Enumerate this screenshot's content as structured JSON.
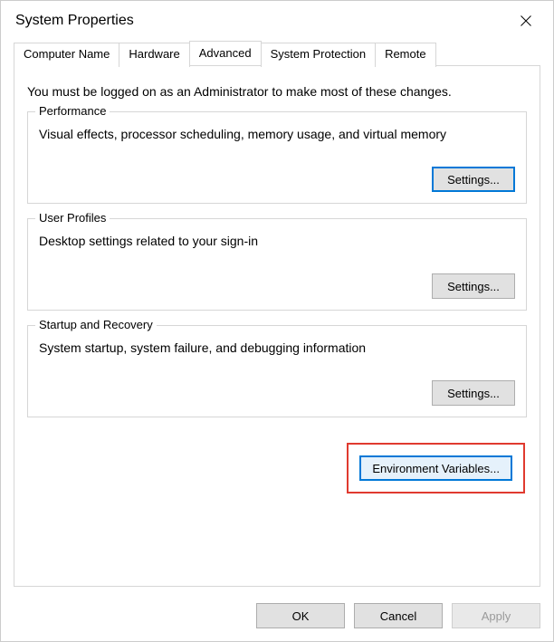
{
  "window": {
    "title": "System Properties"
  },
  "tabs": {
    "items": [
      {
        "label": "Computer Name"
      },
      {
        "label": "Hardware"
      },
      {
        "label": "Advanced"
      },
      {
        "label": "System Protection"
      },
      {
        "label": "Remote"
      }
    ],
    "active_index": 2
  },
  "admin_note": "You must be logged on as an Administrator to make most of these changes.",
  "groups": {
    "performance": {
      "title": "Performance",
      "desc": "Visual effects, processor scheduling, memory usage, and virtual memory",
      "button": "Settings..."
    },
    "user_profiles": {
      "title": "User Profiles",
      "desc": "Desktop settings related to your sign-in",
      "button": "Settings..."
    },
    "startup": {
      "title": "Startup and Recovery",
      "desc": "System startup, system failure, and debugging information",
      "button": "Settings..."
    }
  },
  "env_button": "Environment Variables...",
  "dialog_buttons": {
    "ok": "OK",
    "cancel": "Cancel",
    "apply": "Apply"
  }
}
